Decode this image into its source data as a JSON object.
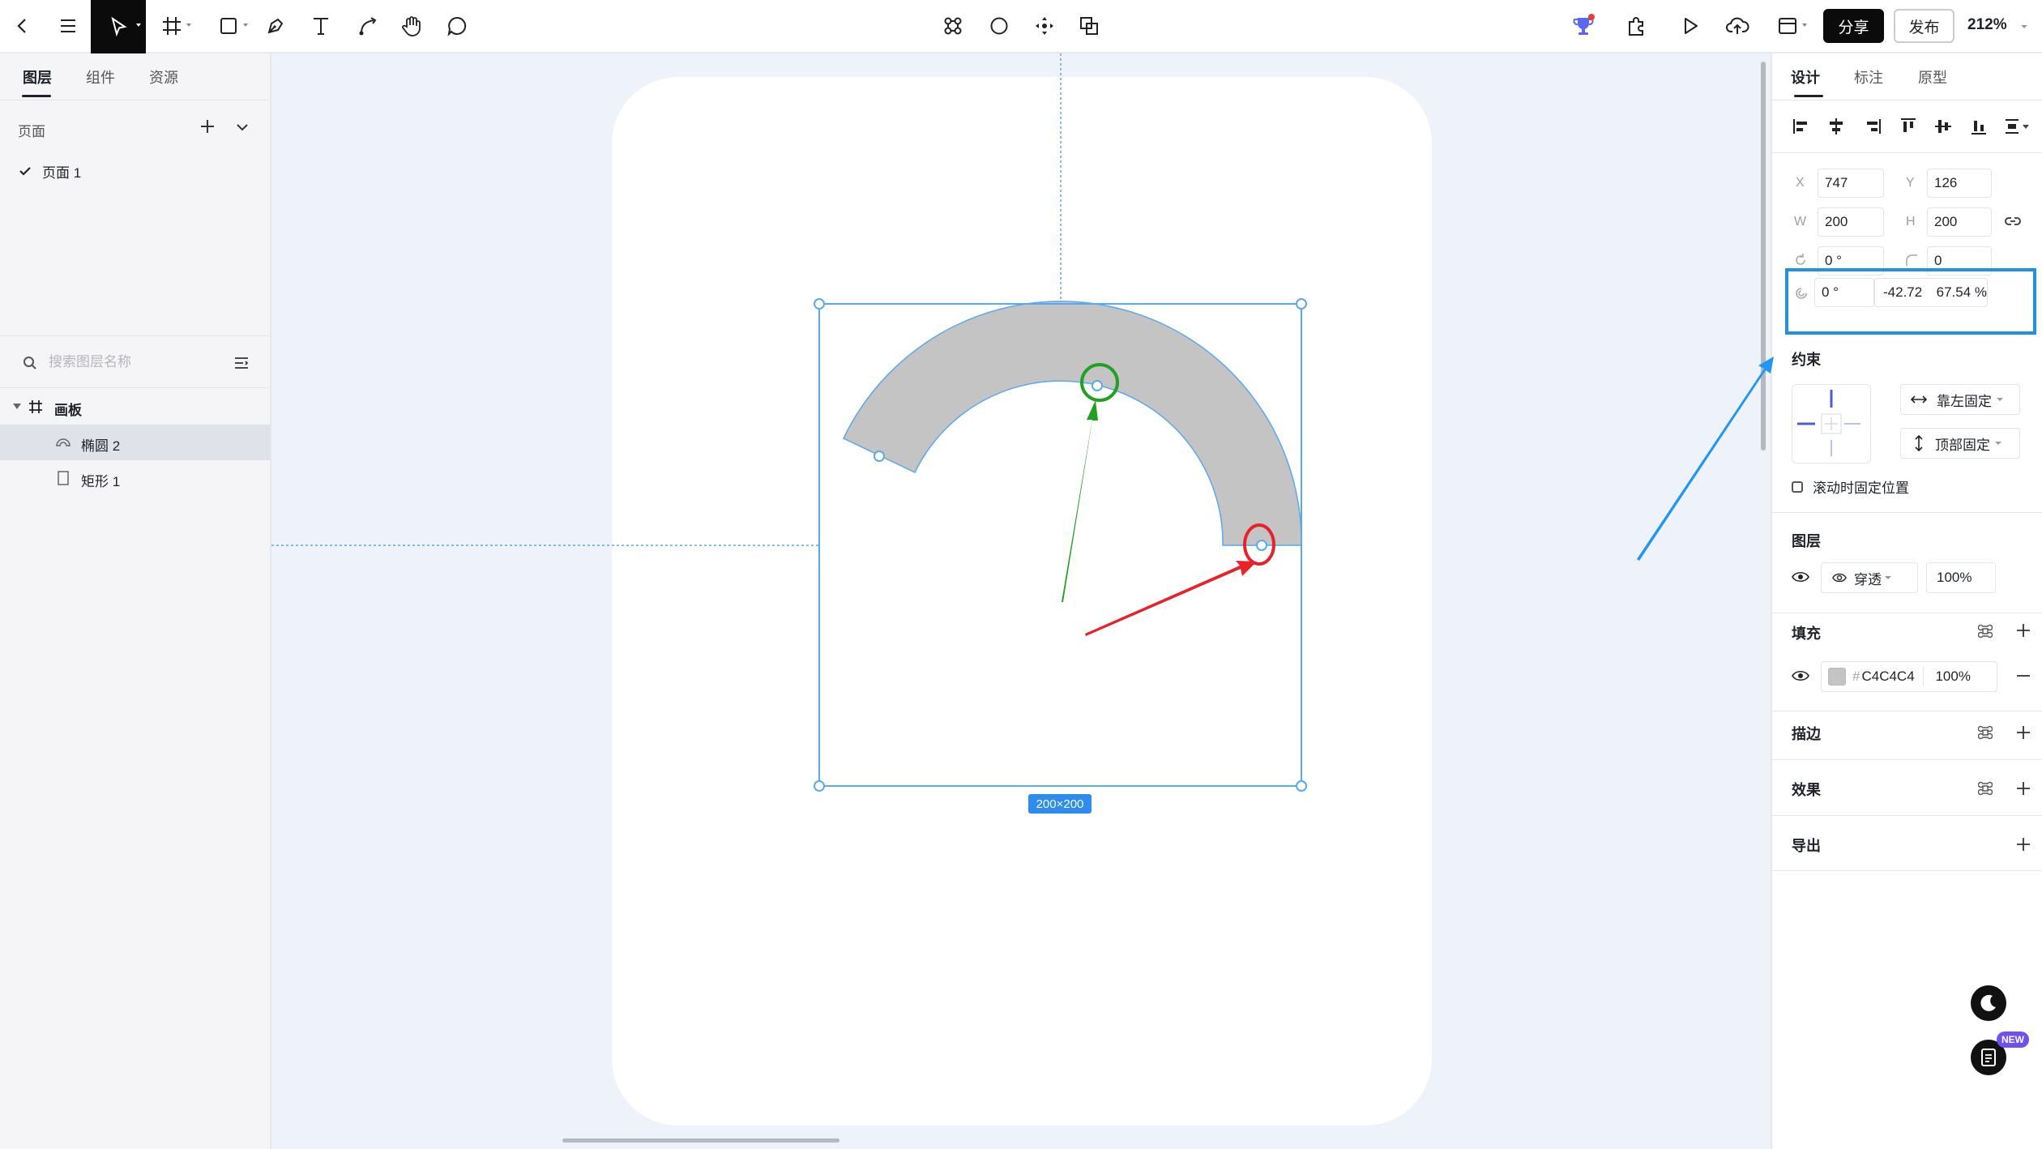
{
  "toolbar": {
    "share_label": "分享",
    "publish_label": "发布",
    "zoom": "212%"
  },
  "left_panel": {
    "tabs": [
      {
        "label": "图层",
        "active": true
      },
      {
        "label": "组件",
        "active": false
      },
      {
        "label": "资源",
        "active": false
      }
    ],
    "pages_header": "页面",
    "pages": [
      {
        "label": "页面 1",
        "selected": true
      }
    ],
    "search": {
      "placeholder": "搜索图层名称"
    },
    "layers": [
      {
        "label": "画板",
        "type": "frame"
      },
      {
        "label": "椭圆 2",
        "type": "ellipse",
        "selected": true
      },
      {
        "label": "矩形 1",
        "type": "rectangle"
      }
    ]
  },
  "canvas": {
    "background": "#eef2fb",
    "selection_size": "200×200",
    "shape_fill": "#C4C4C4",
    "selection_color": "#5aa8ee",
    "annotation_colors": {
      "green": "#22a022",
      "red": "#e8222a",
      "blue": "#2196f3"
    }
  },
  "right_panel": {
    "tabs": [
      {
        "label": "设计",
        "active": true
      },
      {
        "label": "标注",
        "active": false
      },
      {
        "label": "原型",
        "active": false
      }
    ],
    "props": {
      "x_label": "X",
      "x": "747",
      "y_label": "Y",
      "y": "126",
      "w_label": "W",
      "w": "200",
      "h_label": "H",
      "h": "200",
      "rotation": "0 °",
      "radius": "0",
      "arc_start": "0 °",
      "arc_sweep": "-42.72",
      "arc_ratio": "67.54 %"
    },
    "constraints": {
      "title": "约束",
      "horizontal": "靠左固定",
      "vertical": "顶部固定",
      "fixed_scroll": "滚动时固定位置"
    },
    "layer": {
      "title": "图层",
      "blend": "穿透",
      "opacity": "100%"
    },
    "fill": {
      "title": "填充",
      "hex": "C4C4C4",
      "hash": "#",
      "opacity": "100%",
      "swatch": "#C4C4C4"
    },
    "stroke": {
      "title": "描边"
    },
    "effects": {
      "title": "效果"
    },
    "export": {
      "title": "导出"
    }
  },
  "floating": {
    "new_badge": "NEW"
  }
}
